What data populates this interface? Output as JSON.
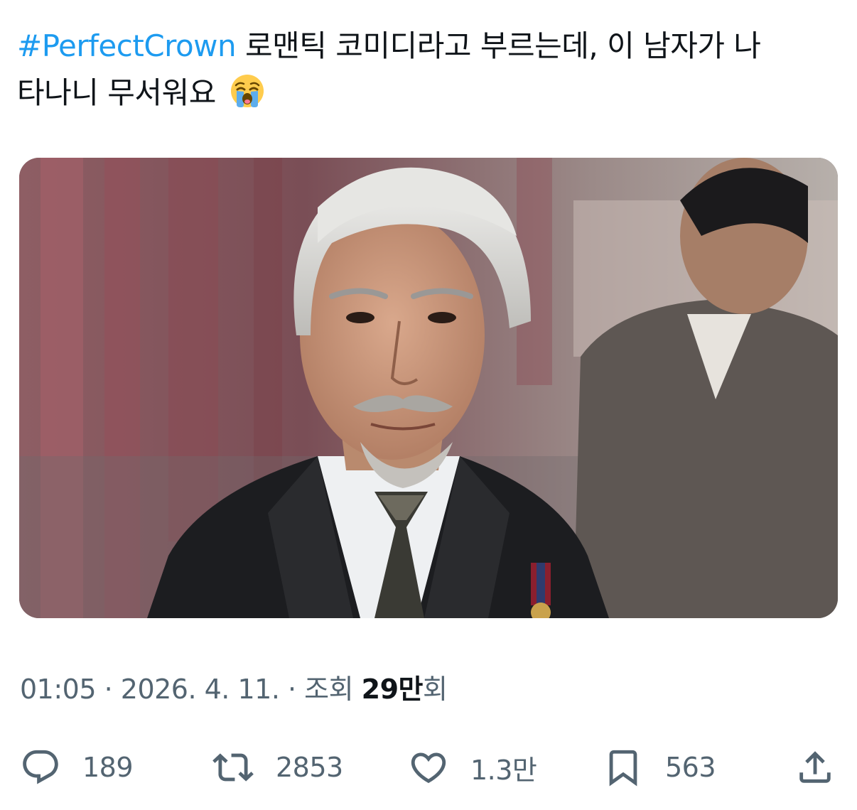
{
  "tweet": {
    "hashtag": "#PerfectCrown",
    "text_line1": " 로맨틱 코미디라고 부르는데, 이 남자가 나",
    "text_line2": "타나니 무서워요",
    "emoji": "loudly-crying-face"
  },
  "meta": {
    "time": "01:05",
    "separator1": " · ",
    "date": "2026. 4. 11.",
    "separator2": " · ",
    "views_label": "조회 ",
    "views_count": "29만",
    "views_suffix": "회"
  },
  "actions": {
    "reply": {
      "icon": "reply-icon",
      "count": "189"
    },
    "repost": {
      "icon": "repost-icon",
      "count": "2853"
    },
    "like": {
      "icon": "heart-icon",
      "count": "1.3만"
    },
    "bookmark": {
      "icon": "bookmark-icon",
      "count": "563"
    },
    "share": {
      "icon": "share-icon"
    }
  },
  "colors": {
    "text": "#0f1419",
    "secondary": "#536471",
    "link": "#1d9bf0"
  }
}
